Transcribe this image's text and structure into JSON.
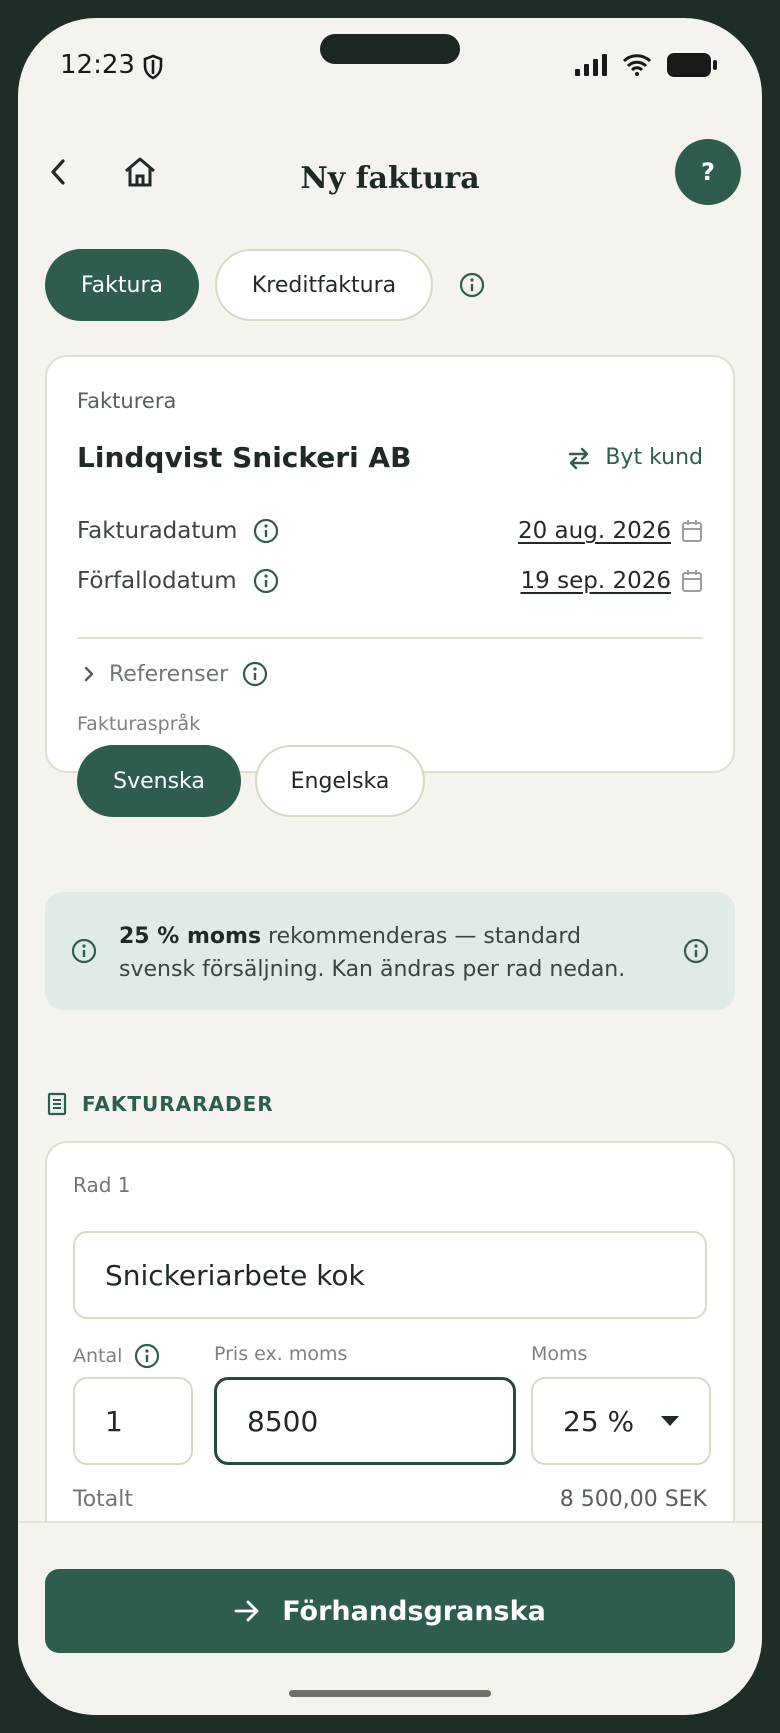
{
  "status": {
    "time": "12:23"
  },
  "header": {
    "title": "Ny faktura",
    "help_label": "?"
  },
  "type_tabs": {
    "invoice": "Faktura",
    "credit": "Kreditfaktura"
  },
  "billing": {
    "label": "Fakturera",
    "customer": "Lindqvist Snickeri AB",
    "change_customer": "Byt kund",
    "invoice_date_label": "Fakturadatum",
    "invoice_date": "20 aug. 2026",
    "due_date_label": "Förfallodatum",
    "due_date": "19 sep. 2026",
    "references_label": "Referenser",
    "language_label": "Fakturaspråk",
    "language_sv": "Svenska",
    "language_en": "Engelska"
  },
  "notice": {
    "bold": "25 % moms",
    "text": " rekommenderas — standard svensk försäljning. Kan ändras per rad nedan."
  },
  "rows_section": {
    "title": "FAKTURARADER",
    "row_label": "Rad 1",
    "description": "Snickeriarbete kok",
    "qty_label": "Antal",
    "qty": "1",
    "price_label": "Pris ex. moms",
    "price": "8500",
    "vat_label": "Moms",
    "vat": "25 %",
    "total_label": "Totalt",
    "total": "8 500,00 SEK"
  },
  "cta": {
    "label": "Förhandsgranska"
  },
  "colors": {
    "primary": "#2e5d4f",
    "background": "#f4f3ee",
    "notice_bg": "#e1ebe6"
  }
}
